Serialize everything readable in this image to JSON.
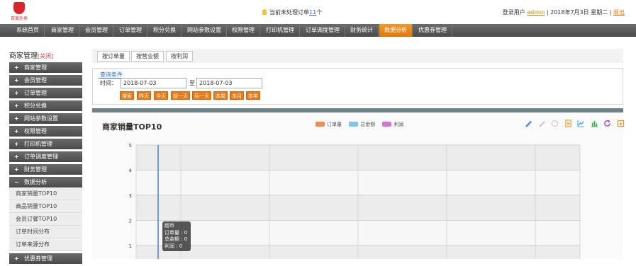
{
  "header": {
    "logo_text": "百度外卖",
    "notice_prefix": "当前未处理订单",
    "notice_count": "11",
    "notice_suffix": "个",
    "login_label": "登录用户",
    "user": "admin",
    "sep1": "|",
    "date": "2018年7月3日 星期二",
    "sep2": "|",
    "logout": "退出"
  },
  "nav": {
    "items": [
      "系统首页",
      "商家管理",
      "会员管理",
      "订单管理",
      "积分兑换",
      "网站参数设置",
      "权限管理",
      "打印机管理",
      "订单调度管理",
      "财务统计",
      "数据分析",
      "优惠券管理"
    ],
    "active_index": 10
  },
  "sidebar": {
    "title": "商家管理",
    "close": "[关闭]",
    "groups": [
      {
        "label": "商家管理",
        "sign": "+"
      },
      {
        "label": "会员管理",
        "sign": "+"
      },
      {
        "label": "订单管理",
        "sign": "+"
      },
      {
        "label": "积分兑换",
        "sign": "+"
      },
      {
        "label": "网站参数设置",
        "sign": "+"
      },
      {
        "label": "权限管理",
        "sign": "+"
      },
      {
        "label": "打印机管理",
        "sign": "+"
      },
      {
        "label": "订单调度管理",
        "sign": "+"
      },
      {
        "label": "财务管理",
        "sign": "+"
      },
      {
        "label": "数据分析",
        "sign": "−"
      }
    ],
    "sub_items": [
      "商家销量TOP10",
      "商品销量TOP10",
      "会员订餐TOP10",
      "订单时间分布",
      "订单来源分布"
    ],
    "last_group": {
      "label": "优惠券管理",
      "sign": "+"
    }
  },
  "tabs": [
    "按订单量",
    "按营业额",
    "按利润"
  ],
  "query": {
    "title": "查询条件",
    "time_label": "时间：",
    "start_date": "2018-07-03",
    "tilde": "至",
    "end_date": "2018-07-03",
    "buttons": [
      "搜索",
      "昨天",
      "今天",
      "前一天",
      "后一天",
      "本周",
      "本月",
      "本年"
    ]
  },
  "chart_data": {
    "type": "bar",
    "title": "商家销量TOP10",
    "series": [
      {
        "name": "订单量",
        "color": "#f38a4e",
        "values": [
          0
        ]
      },
      {
        "name": "总金额",
        "color": "#7fc4ee",
        "values": [
          0
        ]
      },
      {
        "name": "利润",
        "color": "#d472d6",
        "values": [
          0
        ]
      }
    ],
    "categories": [
      "超市"
    ],
    "y_ticks": [
      "5",
      "4",
      "3",
      "2",
      "1"
    ],
    "ylim": [
      0,
      5
    ],
    "grid": true,
    "legend_position": "top-center",
    "tooltip": {
      "category": "超市",
      "lines": [
        "订单量 : 0",
        "总金额 : 0",
        "利润 : 0"
      ]
    }
  },
  "toolbox_icons": [
    "mark-icon",
    "mark-undo-icon",
    "mark-clear-icon",
    "data-view-icon",
    "line-chart-icon",
    "bar-chart-icon",
    "restore-icon",
    "save-image-icon"
  ]
}
